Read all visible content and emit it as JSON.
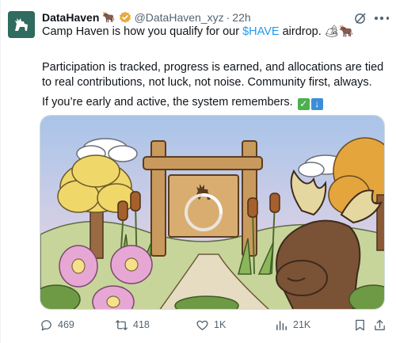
{
  "tweet": {
    "author": {
      "display_name": "DataHaven",
      "name_emoji": "🐂",
      "handle": "@DataHaven_xyz",
      "separator": "·",
      "time": "22h"
    },
    "text": {
      "line1_before": "Camp Haven is how you qualify for our ",
      "cashtag": "$HAVE",
      "line1_after": " airdrop. ",
      "line1_emojis": "🏕🐂",
      "para2": "Participation is tracked, progress is earned, and allocations are tied to real contributions, not luck, not noise. Community first, always.",
      "para3": "If you’re early and active, the system remembers.",
      "para3_emoji_check": "✓",
      "para3_emoji_down": "↓"
    },
    "actions": {
      "replies": "469",
      "reposts": "418",
      "likes": "1K",
      "views": "21K"
    }
  },
  "colors": {
    "accent": "#1d9bf0",
    "secondary_text": "#536471",
    "avatar_bg": "#2f6b5e",
    "verified_badge": "#e8a93a"
  },
  "icons": [
    "grok-icon",
    "more-icon",
    "reply-icon",
    "repost-icon",
    "like-icon",
    "views-icon",
    "bookmark-icon",
    "share-icon",
    "verified-badge-icon"
  ]
}
